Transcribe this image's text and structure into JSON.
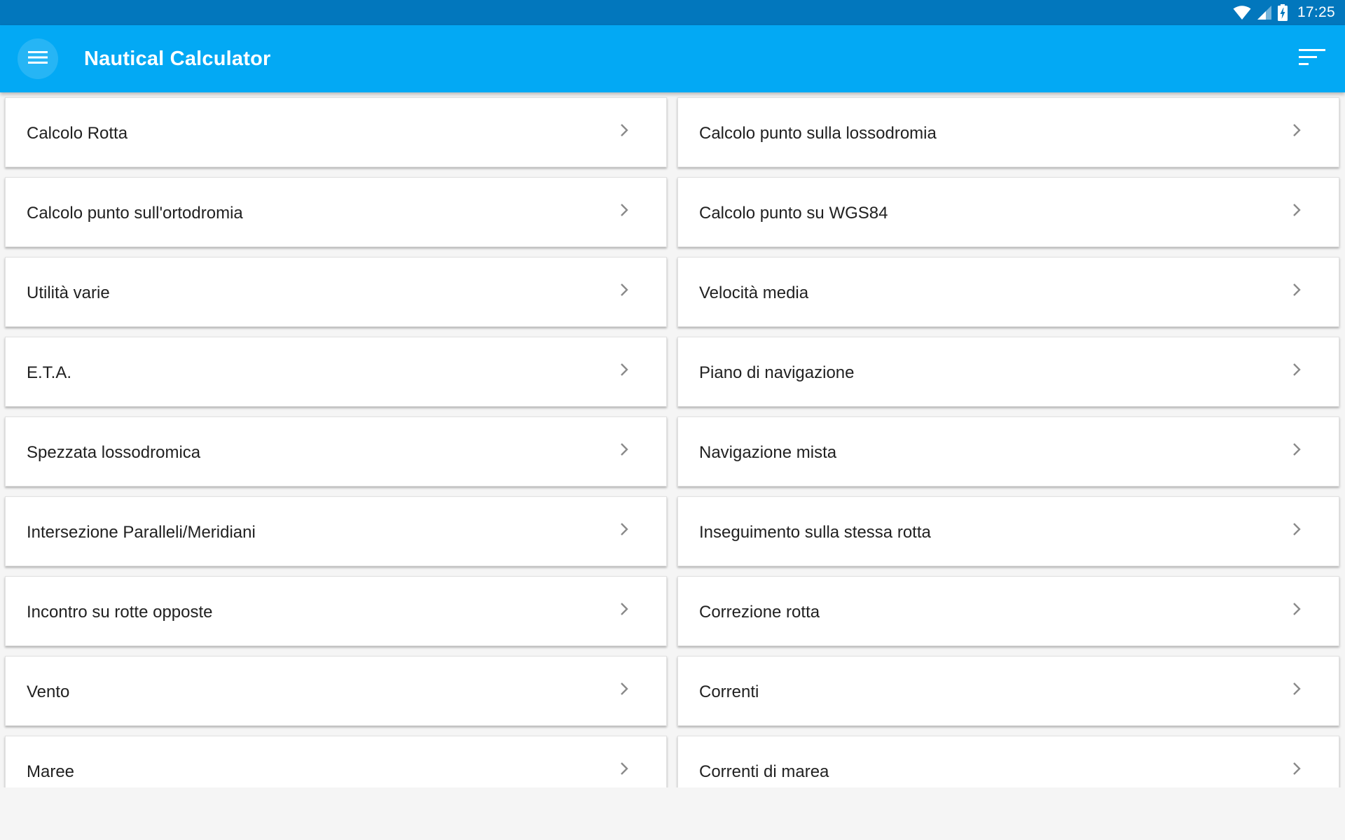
{
  "status_bar": {
    "time": "17:25",
    "icons": [
      "wifi-icon",
      "cell-signal-icon",
      "battery-charging-icon"
    ]
  },
  "app_bar": {
    "title": "Nautical Calculator",
    "menu_icon": "hamburger-menu-icon",
    "sort_icon": "sort-icon"
  },
  "colors": {
    "status_bar": "#0277bd",
    "app_bar": "#03a9f4",
    "card": "#ffffff",
    "background": "#f5f5f5",
    "text": "#212121",
    "chevron": "#8a8a8a"
  },
  "menu": {
    "chevron_icon": "chevron-right-icon",
    "items": [
      {
        "label": "Calcolo Rotta"
      },
      {
        "label": "Calcolo punto sulla lossodromia"
      },
      {
        "label": "Calcolo punto sull'ortodromia"
      },
      {
        "label": "Calcolo punto su WGS84"
      },
      {
        "label": "Utilità varie"
      },
      {
        "label": "Velocità media"
      },
      {
        "label": "E.T.A."
      },
      {
        "label": "Piano di navigazione"
      },
      {
        "label": "Spezzata lossodromica"
      },
      {
        "label": "Navigazione mista"
      },
      {
        "label": "Intersezione Paralleli/Meridiani"
      },
      {
        "label": "Inseguimento sulla stessa rotta"
      },
      {
        "label": "Incontro su rotte opposte"
      },
      {
        "label": "Correzione rotta"
      },
      {
        "label": "Vento"
      },
      {
        "label": "Correnti"
      },
      {
        "label": "Maree"
      },
      {
        "label": "Correnti di marea"
      }
    ]
  }
}
